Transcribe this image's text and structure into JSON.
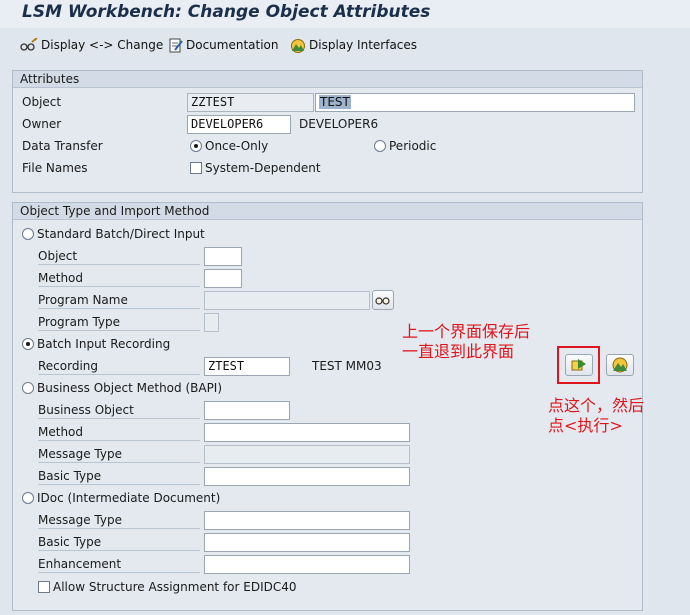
{
  "window": {
    "title": "LSM Workbench: Change Object Attributes"
  },
  "toolbar": {
    "display_change": "Display <-> Change",
    "documentation": "Documentation",
    "display_interfaces": "Display Interfaces"
  },
  "attributes": {
    "header": "Attributes",
    "object_label": "Object",
    "object_value": "ZZTEST",
    "object_desc": "TEST",
    "owner_label": "Owner",
    "owner_value": "DEVELOPER6",
    "owner_name": "DEVELOPER6",
    "data_transfer_label": "Data Transfer",
    "once_only": "Once-Only",
    "periodic": "Periodic",
    "file_names_label": "File Names",
    "system_dependent": "System-Dependent",
    "selected_transfer": "once-only"
  },
  "import": {
    "header": "Object Type and Import Method",
    "standard_batch": "Standard Batch/Direct Input",
    "object_label": "Object",
    "method_label": "Method",
    "program_name_label": "Program Name",
    "program_type_label": "Program Type",
    "batch_input_recording": "Batch Input Recording",
    "recording_label": "Recording",
    "recording_value": "ZTEST",
    "recording_desc": "TEST MM03",
    "bapi": "Business Object Method  (BAPI)",
    "business_object_label": "Business Object",
    "bapi_method_label": "Method",
    "bapi_message_type_label": "Message Type",
    "bapi_basic_type_label": "Basic Type",
    "idoc": "IDoc (Intermediate Document)",
    "idoc_message_type_label": "Message Type",
    "idoc_basic_type_label": "Basic Type",
    "enhancement_label": "Enhancement",
    "allow_structure": "Allow Structure Assignment for EDIDC40",
    "selected_method": "batch-input-recording"
  },
  "annotations": {
    "note1_line1": "上一个界面保存后",
    "note1_line2": "一直退到此界面",
    "note2_line1": "点这个，然后",
    "note2_line2": "点<执行>"
  },
  "icons": {
    "display_change": "glasses-pencil-icon",
    "documentation": "document-pencil-icon",
    "display_interfaces": "mountain-interface-icon",
    "program_name_action": "glasses-icon",
    "recording_edit": "edit-forward-icon",
    "recording_display": "mountain-display-icon"
  },
  "colors": {
    "annotation": "#e0141b",
    "highlight": "#9db2cc"
  }
}
